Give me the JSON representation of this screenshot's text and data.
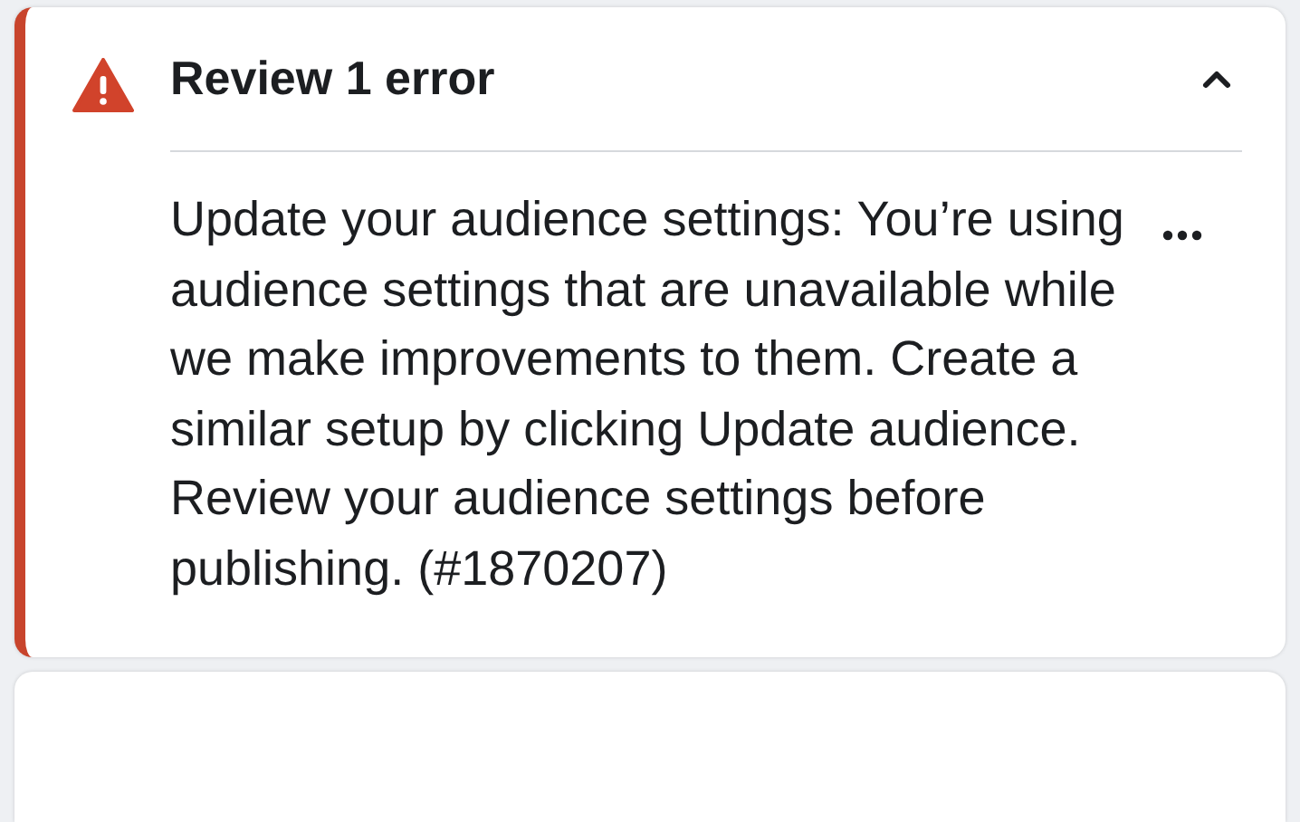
{
  "alert": {
    "title": "Review 1 error",
    "expanded": true,
    "message": "Update your audience settings: You’re using audience settings that are unavailable while we make improvements to them. Create a similar setup by clicking Update audience. Review your audience settings before publishing. (#1870207)"
  }
}
